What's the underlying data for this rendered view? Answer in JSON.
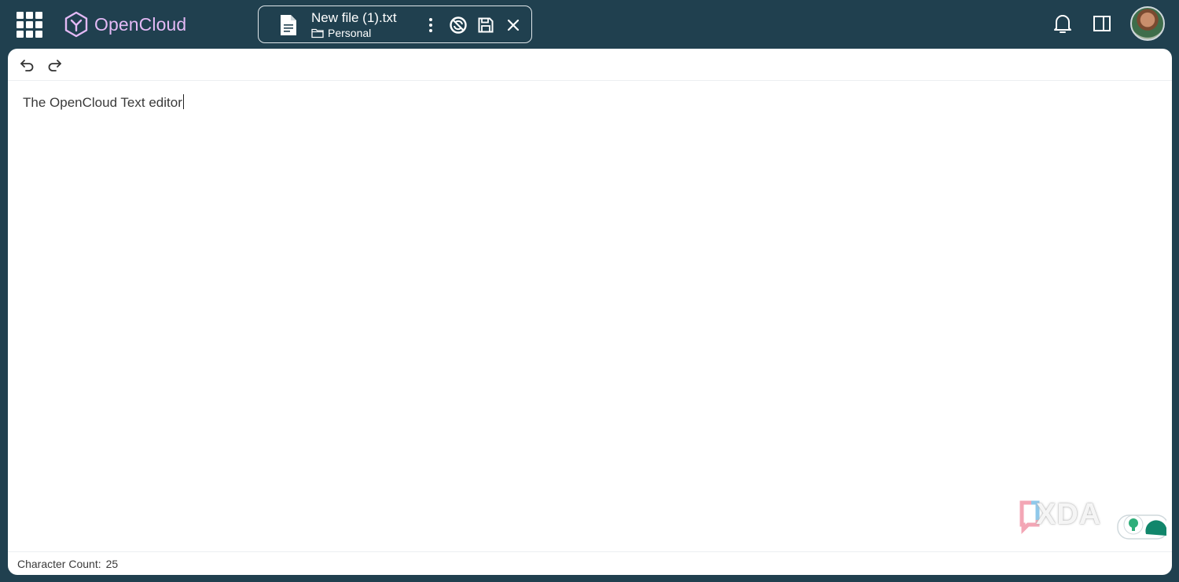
{
  "app": {
    "name": "OpenCloud",
    "accent_color": "#e3b9f5",
    "header_bg": "#20404f"
  },
  "header": {
    "apps_icon": "app-grid-icon",
    "file": {
      "name": "New file (1).txt",
      "location": "Personal",
      "file_icon": "text-file-icon",
      "folder_icon": "folder-icon"
    },
    "actions": {
      "more_icon": "more-vertical-icon",
      "autosave_icon": "autosave-off-icon",
      "save_icon": "save-icon",
      "close_icon": "close-icon"
    },
    "right": {
      "notifications_icon": "bell-icon",
      "sidebar_icon": "sidebar-panel-icon",
      "avatar_icon": "user-avatar"
    }
  },
  "toolbar": {
    "undo_icon": "undo-icon",
    "redo_icon": "redo-icon"
  },
  "editor": {
    "content": "The OpenCloud Text editor"
  },
  "status": {
    "char_count_label": "Character Count:",
    "char_count_value": "25"
  },
  "watermark": {
    "text": "XDA"
  }
}
